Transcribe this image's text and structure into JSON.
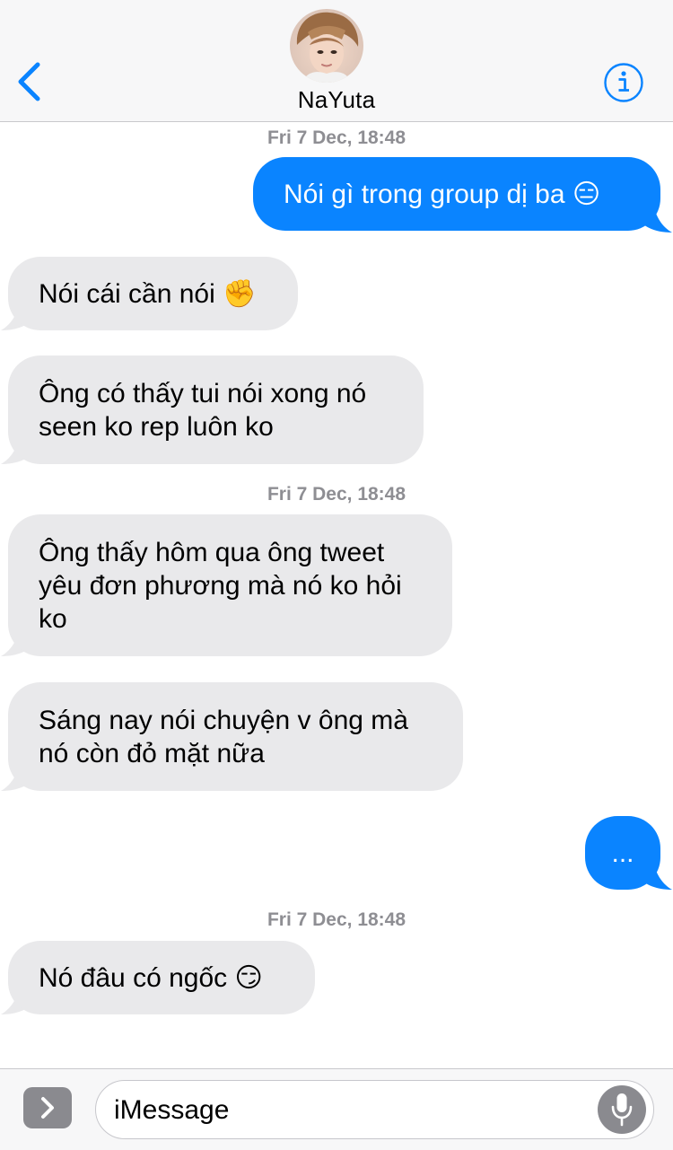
{
  "header": {
    "contact_name": "NaYuta",
    "back_icon": "chevron-left-icon",
    "info_icon": "info-icon",
    "accent_color": "#0a84ff"
  },
  "conversation": {
    "timestamps": [
      "Fri 7 Dec, 18:48",
      "Fri 7 Dec, 18:48",
      "Fri 7 Dec, 18:48"
    ],
    "messages": [
      {
        "direction": "outgoing",
        "text": "Nói gì trong group dị ba 😑"
      },
      {
        "direction": "incoming",
        "text": "Nói cái cần nói ✊"
      },
      {
        "direction": "incoming",
        "text": "Ông có thấy tui nói xong nó\nseen ko rep luôn ko"
      },
      {
        "direction": "incoming",
        "text": "Ông thấy hôm qua ông tweet\nyêu đơn phương mà nó ko hỏi\nko"
      },
      {
        "direction": "incoming",
        "text": "Sáng nay nói chuyện v ông mà\nnó còn đỏ mặt nữa"
      },
      {
        "direction": "outgoing",
        "text": "..."
      },
      {
        "direction": "incoming",
        "text": "Nó đâu có ngốc 😏"
      }
    ],
    "incoming_bubble_color": "#e9e9eb",
    "outgoing_bubble_color": "#0a84ff"
  },
  "input_bar": {
    "placeholder": "iMessage",
    "apps_icon": "chevron-right-icon",
    "mic_icon": "microphone-icon"
  }
}
